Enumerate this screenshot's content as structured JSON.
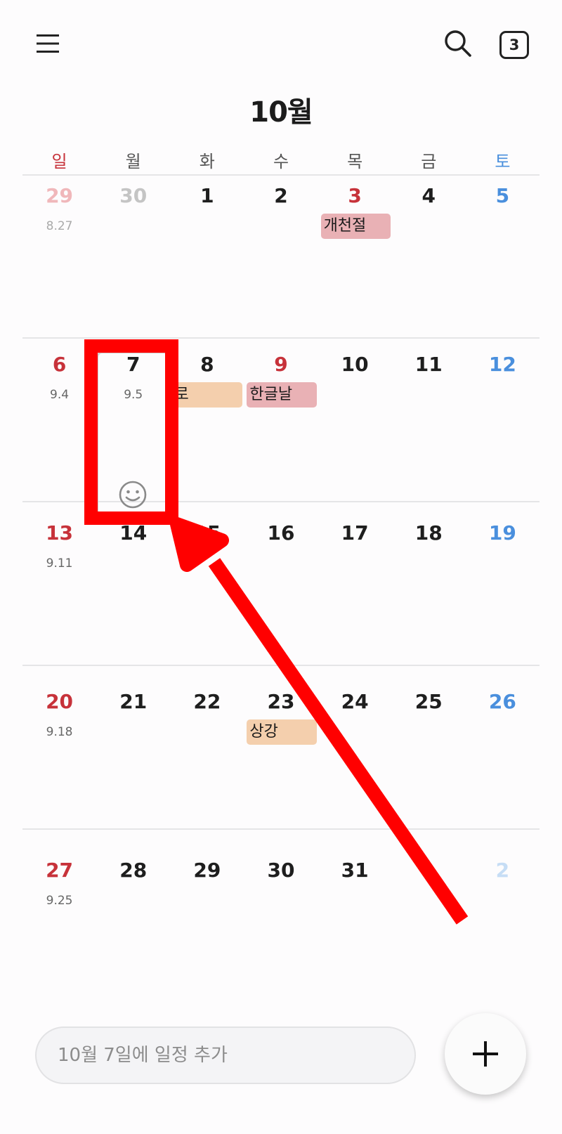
{
  "header": {
    "menu_icon": "hamburger-menu-icon",
    "search_icon": "search-icon",
    "today_badge": "3"
  },
  "month_title": "10월",
  "weekdays": [
    {
      "label": "일",
      "color": "#c7323a"
    },
    {
      "label": "월",
      "color": "#555555"
    },
    {
      "label": "화",
      "color": "#555555"
    },
    {
      "label": "수",
      "color": "#555555"
    },
    {
      "label": "목",
      "color": "#555555"
    },
    {
      "label": "금",
      "color": "#555555"
    },
    {
      "label": "토",
      "color": "#4a8fdd"
    }
  ],
  "weeks": [
    [
      {
        "day": "29",
        "lunar": "8.27",
        "color": "#f0b7ba"
      },
      {
        "day": "30",
        "lunar": "",
        "color": "#c4c4c4"
      },
      {
        "day": "1",
        "lunar": "",
        "color": "#1e1e1e"
      },
      {
        "day": "2",
        "lunar": "",
        "color": "#1e1e1e"
      },
      {
        "day": "3",
        "lunar": "",
        "color": "#c7323a"
      },
      {
        "day": "4",
        "lunar": "",
        "color": "#1e1e1e"
      },
      {
        "day": "5",
        "lunar": "",
        "color": "#4a8fdd"
      }
    ],
    [
      {
        "day": "6",
        "lunar": "9.4",
        "color": "#c7323a"
      },
      {
        "day": "7",
        "lunar": "9.5",
        "color": "#1e1e1e"
      },
      {
        "day": "8",
        "lunar": "",
        "color": "#1e1e1e"
      },
      {
        "day": "9",
        "lunar": "",
        "color": "#c7323a"
      },
      {
        "day": "10",
        "lunar": "",
        "color": "#1e1e1e"
      },
      {
        "day": "11",
        "lunar": "",
        "color": "#1e1e1e"
      },
      {
        "day": "12",
        "lunar": "",
        "color": "#4a8fdd"
      }
    ],
    [
      {
        "day": "13",
        "lunar": "9.11",
        "color": "#c7323a"
      },
      {
        "day": "14",
        "lunar": "",
        "color": "#1e1e1e"
      },
      {
        "day": "15",
        "lunar": "",
        "color": "#1e1e1e"
      },
      {
        "day": "16",
        "lunar": "",
        "color": "#1e1e1e"
      },
      {
        "day": "17",
        "lunar": "",
        "color": "#1e1e1e"
      },
      {
        "day": "18",
        "lunar": "",
        "color": "#1e1e1e"
      },
      {
        "day": "19",
        "lunar": "",
        "color": "#4a8fdd"
      }
    ],
    [
      {
        "day": "20",
        "lunar": "9.18",
        "color": "#c7323a"
      },
      {
        "day": "21",
        "lunar": "",
        "color": "#1e1e1e"
      },
      {
        "day": "22",
        "lunar": "",
        "color": "#1e1e1e"
      },
      {
        "day": "23",
        "lunar": "",
        "color": "#1e1e1e"
      },
      {
        "day": "24",
        "lunar": "",
        "color": "#1e1e1e"
      },
      {
        "day": "25",
        "lunar": "",
        "color": "#1e1e1e"
      },
      {
        "day": "26",
        "lunar": "",
        "color": "#4a8fdd"
      }
    ],
    [
      {
        "day": "27",
        "lunar": "9.25",
        "color": "#c7323a"
      },
      {
        "day": "28",
        "lunar": "",
        "color": "#1e1e1e"
      },
      {
        "day": "29",
        "lunar": "",
        "color": "#1e1e1e"
      },
      {
        "day": "30",
        "lunar": "",
        "color": "#1e1e1e"
      },
      {
        "day": "31",
        "lunar": "",
        "color": "#1e1e1e"
      },
      {
        "day": "",
        "lunar": "",
        "color": "#1e1e1e"
      },
      {
        "day": "2",
        "lunar": "",
        "color": "#c6ddf5"
      }
    ]
  ],
  "events": [
    {
      "label": "개천절",
      "week": 0,
      "day": 4,
      "color": "#e9b1b5"
    },
    {
      "label": "한로",
      "week": 1,
      "day": 2,
      "color": "#f4cfad",
      "clipped": true
    },
    {
      "label": "한글날",
      "week": 1,
      "day": 3,
      "color": "#e9b1b5"
    },
    {
      "label": "상강",
      "week": 3,
      "day": 3,
      "color": "#f4cfad"
    }
  ],
  "selected_day_icon": "smiley-face-icon",
  "add_event": {
    "placeholder": "10월 7일에 일정 추가",
    "fab_icon": "plus-icon"
  },
  "annotation": {
    "color": "#ff0000"
  }
}
